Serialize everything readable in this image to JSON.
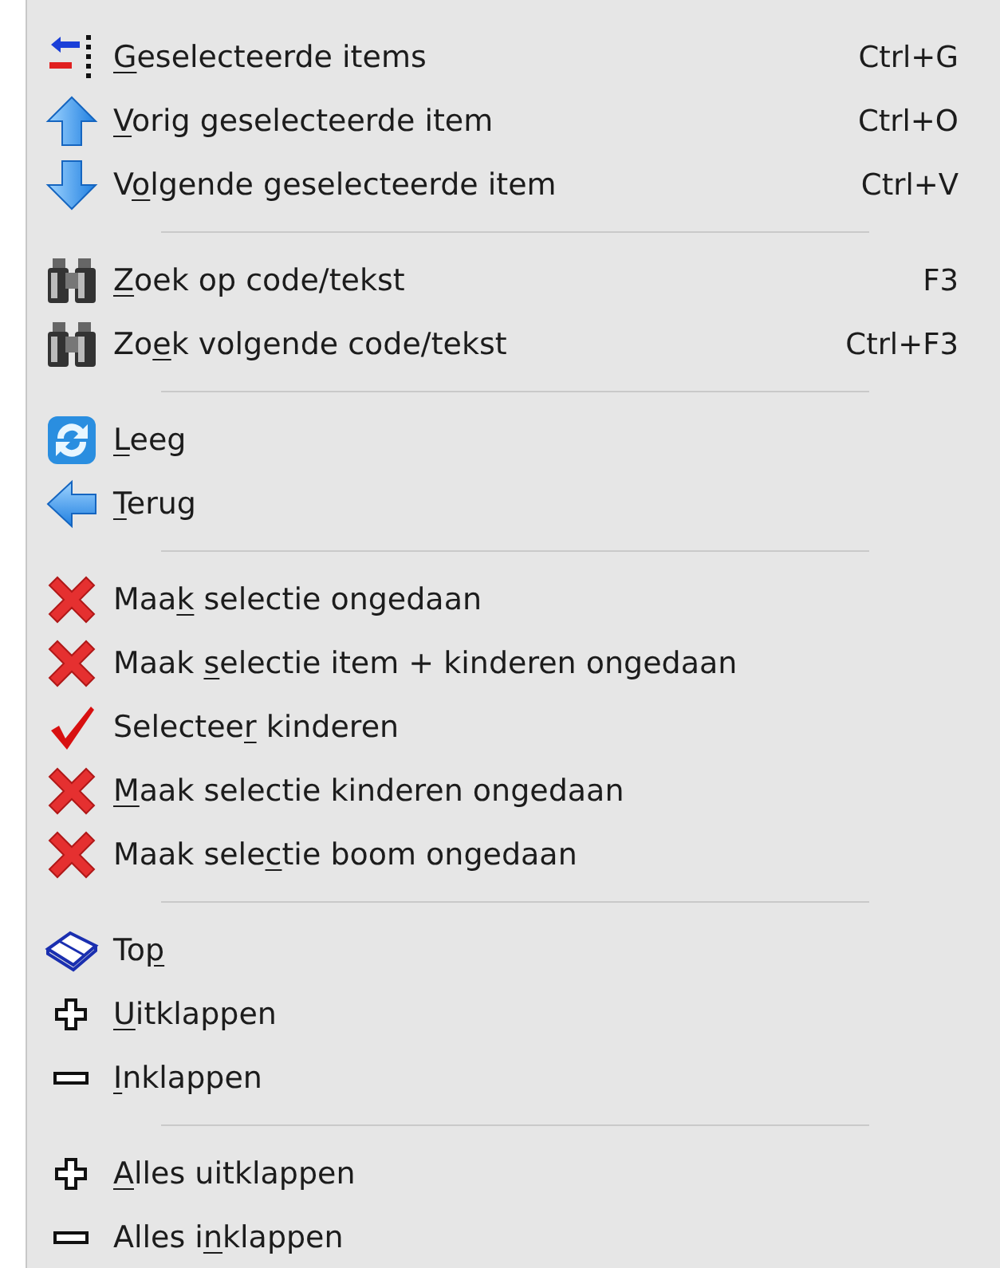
{
  "menu": {
    "sections": [
      {
        "items": [
          {
            "kind": "goto-selected",
            "access_key": "G",
            "label_post": "eselecteerde items",
            "shortcut": "Ctrl+G"
          },
          {
            "kind": "arrow-up",
            "access_key": "V",
            "label_post": "orig geselecteerde item",
            "shortcut": "Ctrl+O"
          },
          {
            "kind": "arrow-down",
            "label_pre": "V",
            "access_key": "o",
            "label_post": "lgende geselecteerde item",
            "shortcut": "Ctrl+V"
          }
        ]
      },
      {
        "items": [
          {
            "kind": "binoculars",
            "access_key": "Z",
            "label_post": "oek op code/tekst",
            "shortcut": "F3"
          },
          {
            "kind": "binoculars",
            "label_pre": "Zo",
            "access_key": "e",
            "label_post": "k volgende code/tekst",
            "shortcut": "Ctrl+F3"
          }
        ]
      },
      {
        "items": [
          {
            "kind": "refresh",
            "access_key": "L",
            "label_post": "eeg"
          },
          {
            "kind": "arrow-left",
            "access_key": "T",
            "label_post": "erug"
          }
        ]
      },
      {
        "items": [
          {
            "kind": "cross",
            "label_pre": "Maa",
            "access_key": "k",
            "label_post": " selectie ongedaan"
          },
          {
            "kind": "cross",
            "label_pre": "Maak ",
            "access_key": "s",
            "label_post": "electie item + kinderen ongedaan"
          },
          {
            "kind": "check",
            "label_pre": "Selectee",
            "access_key": "r",
            "label_post": " kinderen"
          },
          {
            "kind": "cross",
            "access_key": "M",
            "label_post": "aak selectie kinderen ongedaan"
          },
          {
            "kind": "cross",
            "label_pre": "Maak sele",
            "access_key": "c",
            "label_post": "tie boom ongedaan"
          }
        ]
      },
      {
        "items": [
          {
            "kind": "book",
            "label_pre": "To",
            "access_key": "p"
          },
          {
            "kind": "plus",
            "access_key": "U",
            "label_post": "itklappen"
          },
          {
            "kind": "minus",
            "access_key": "I",
            "label_post": "nklappen"
          }
        ]
      },
      {
        "items": [
          {
            "kind": "plus",
            "access_key": "A",
            "label_post": "lles uitklappen"
          },
          {
            "kind": "minus",
            "label_pre": "Alles i",
            "access_key": "n",
            "label_post": "klappen"
          }
        ]
      }
    ]
  }
}
